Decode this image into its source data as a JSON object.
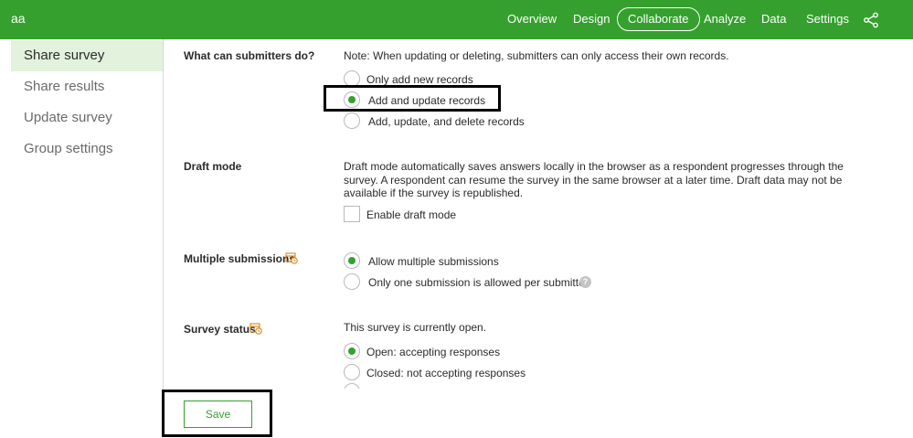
{
  "app": {
    "title": "aa"
  },
  "nav": {
    "items": [
      {
        "label": "Overview"
      },
      {
        "label": "Design"
      },
      {
        "label": "Collaborate",
        "active": true
      },
      {
        "label": "Analyze"
      },
      {
        "label": "Data"
      },
      {
        "label": "Settings"
      }
    ],
    "share_icon": "share-icon"
  },
  "sidebar": {
    "items": [
      {
        "label": "Share survey",
        "active": true
      },
      {
        "label": "Share results"
      },
      {
        "label": "Update survey"
      },
      {
        "label": "Group settings"
      }
    ]
  },
  "submitters": {
    "label": "What can submitters do?",
    "note": "Note: When updating or deleting, submitters can only access their own records.",
    "options": [
      {
        "label": "Only add new records",
        "checked": false
      },
      {
        "label": "Add and update records",
        "checked": true
      },
      {
        "label": "Add, update, and delete records",
        "checked": false
      }
    ]
  },
  "draft": {
    "label": "Draft mode",
    "description": "Draft mode automatically saves answers locally in the browser as a respondent progresses through the survey. A respondent can resume the survey in the same browser at a later time. Draft data may not be available if the survey is republished.",
    "checkbox_label": "Enable draft mode",
    "checked": false
  },
  "multiple": {
    "label": "Multiple submissions",
    "icon": "calendar-schedule-icon",
    "options": [
      {
        "label": "Allow multiple submissions",
        "checked": true
      },
      {
        "label": "Only one submission is allowed per submitter",
        "checked": false
      }
    ],
    "help_icon": "help-icon"
  },
  "status": {
    "label": "Survey status",
    "icon": "calendar-schedule-icon",
    "description": "This survey is currently open.",
    "options": [
      {
        "label": "Open: accepting responses",
        "checked": true
      },
      {
        "label": "Closed: not accepting responses",
        "checked": false
      }
    ]
  },
  "save": {
    "label": "Save"
  },
  "colors": {
    "brand": "#35a02e",
    "active_bg": "#e2f2dc",
    "highlight": "#000000"
  }
}
